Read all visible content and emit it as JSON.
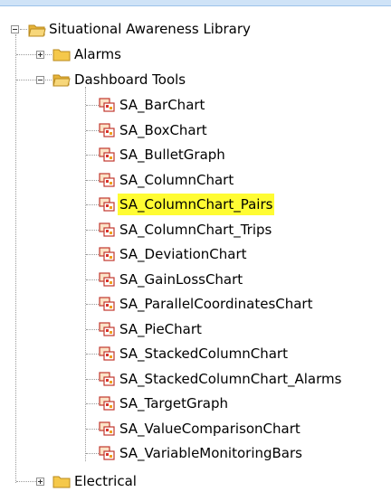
{
  "tree": {
    "root": {
      "label": "Situational Awareness Library",
      "icon": "folder-open-icon"
    },
    "folders": {
      "alarms": {
        "label": "Alarms",
        "icon": "folder-icon"
      },
      "dashboard_tools": {
        "label": "Dashboard Tools",
        "icon": "folder-open-icon"
      },
      "electrical": {
        "label": "Electrical",
        "icon": "folder-icon"
      }
    },
    "items": [
      {
        "label": "SA_BarChart"
      },
      {
        "label": "SA_BoxChart"
      },
      {
        "label": "SA_BulletGraph"
      },
      {
        "label": "SA_ColumnChart"
      },
      {
        "label": "SA_ColumnChart_Pairs",
        "selected": true
      },
      {
        "label": "SA_ColumnChart_Trips"
      },
      {
        "label": "SA_DeviationChart"
      },
      {
        "label": "SA_GainLossChart"
      },
      {
        "label": "SA_ParallelCoordinatesChart"
      },
      {
        "label": "SA_PieChart"
      },
      {
        "label": "SA_StackedColumnChart"
      },
      {
        "label": "SA_StackedColumnChart_Alarms"
      },
      {
        "label": "SA_TargetGraph"
      },
      {
        "label": "SA_ValueComparisonChart"
      },
      {
        "label": "SA_VariableMonitoringBars"
      }
    ],
    "colors": {
      "selection": "#fffc33",
      "folder": "#f5c84a",
      "item_icon": "#d9342b"
    }
  }
}
